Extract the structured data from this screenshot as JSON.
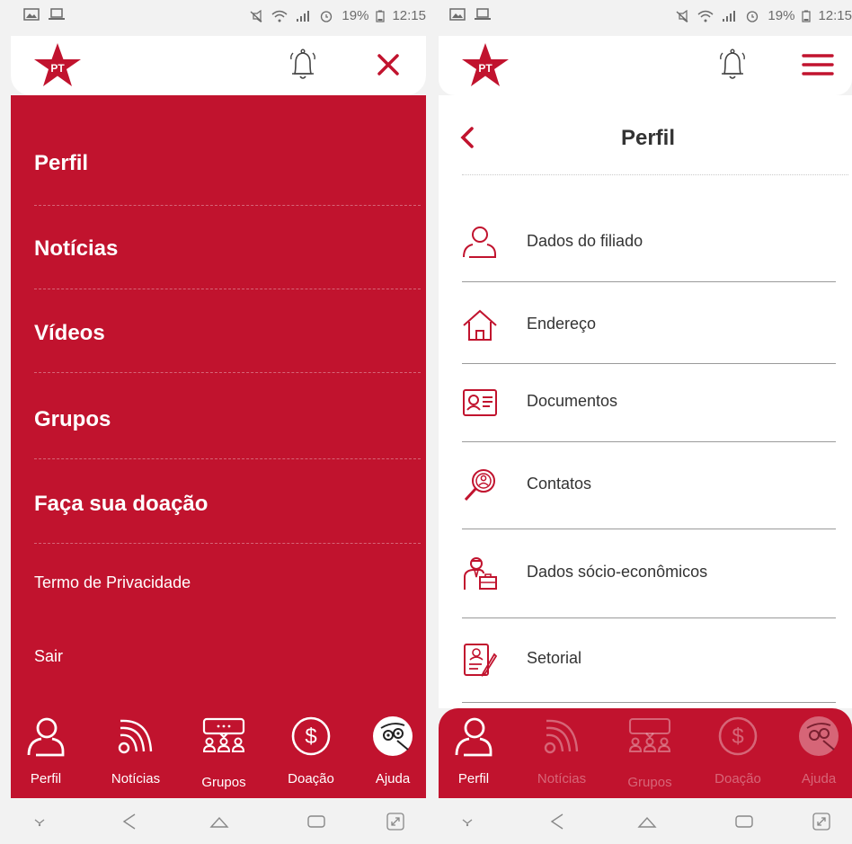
{
  "status_bar": {
    "battery": "19%",
    "time": "12:15"
  },
  "left_screen": {
    "menu": [
      {
        "label": "Perfil"
      },
      {
        "label": "Notícias"
      },
      {
        "label": "Vídeos"
      },
      {
        "label": "Grupos"
      },
      {
        "label": "Faça sua doação"
      }
    ],
    "privacy": "Termo de Privacidade",
    "logout": "Sair"
  },
  "right_screen": {
    "title": "Perfil",
    "items": [
      {
        "label": "Dados do filiado",
        "icon": "person-icon"
      },
      {
        "label": "Endereço",
        "icon": "house-icon"
      },
      {
        "label": "Documentos",
        "icon": "id-card-icon"
      },
      {
        "label": "Contatos",
        "icon": "magnifier-contact-icon"
      },
      {
        "label": "Dados sócio-econômicos",
        "icon": "worker-briefcase-icon"
      },
      {
        "label": "Setorial",
        "icon": "document-pen-icon"
      }
    ]
  },
  "bottom_nav": {
    "items": [
      {
        "label": "Perfil",
        "icon": "person-icon"
      },
      {
        "label": "Notícias",
        "icon": "rss-icon"
      },
      {
        "label": "Grupos",
        "icon": "group-icon"
      },
      {
        "label": "Doação",
        "icon": "dollar-icon"
      },
      {
        "label": "Ajuda",
        "icon": "help-mascot-icon"
      }
    ]
  },
  "colors": {
    "brand_red": "#c1132e",
    "text_dark": "#333333",
    "background": "#f2f2f2"
  }
}
